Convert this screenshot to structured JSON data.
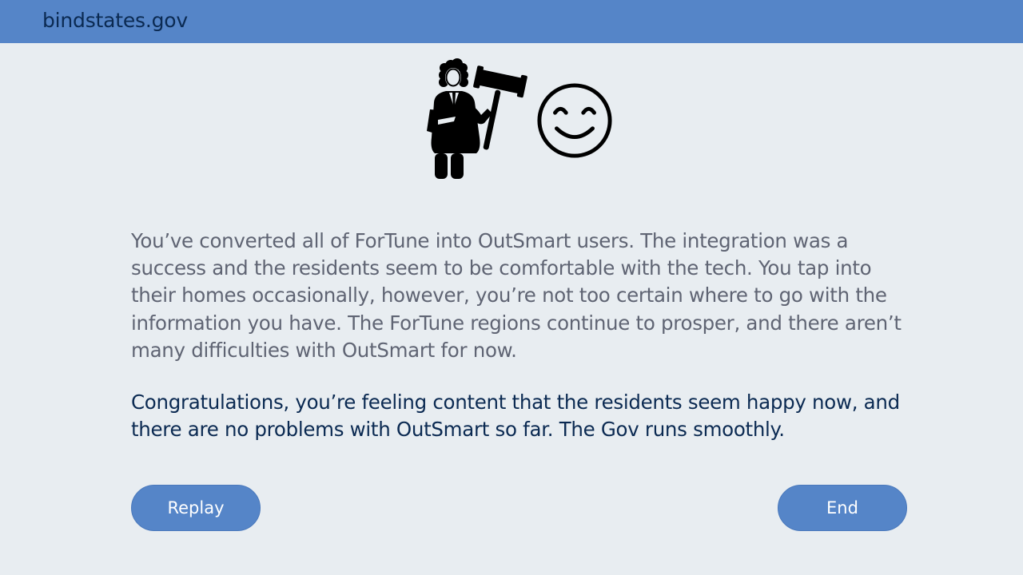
{
  "header": {
    "site_name": "bindstates.gov"
  },
  "illustration": {
    "icons": [
      "judge-with-gavel-icon",
      "smiley-face-icon"
    ]
  },
  "story": {
    "paragraph": "You’ve converted all of ForTune into OutSmart users. The integration was a success and the residents seem to be comfortable with the tech. You tap into their homes occasionally, however, you’re not too certain where to go with the information you have. The ForTune regions continue to prosper, and there aren’t many difficulties with OutSmart for now.",
    "outcome": "Congratulations, you’re feeling content that the residents seem happy now, and there are no problems with OutSmart so far. The Gov runs smoothly."
  },
  "actions": {
    "replay_label": "Replay",
    "end_label": "End"
  },
  "colors": {
    "header_bg": "#5585c8",
    "page_bg": "#e8edf1",
    "header_text": "#0b2a52",
    "body_text": "#5f6473",
    "outcome_text": "#0b2a52",
    "button_bg": "#5585c8",
    "button_text": "#ffffff"
  }
}
